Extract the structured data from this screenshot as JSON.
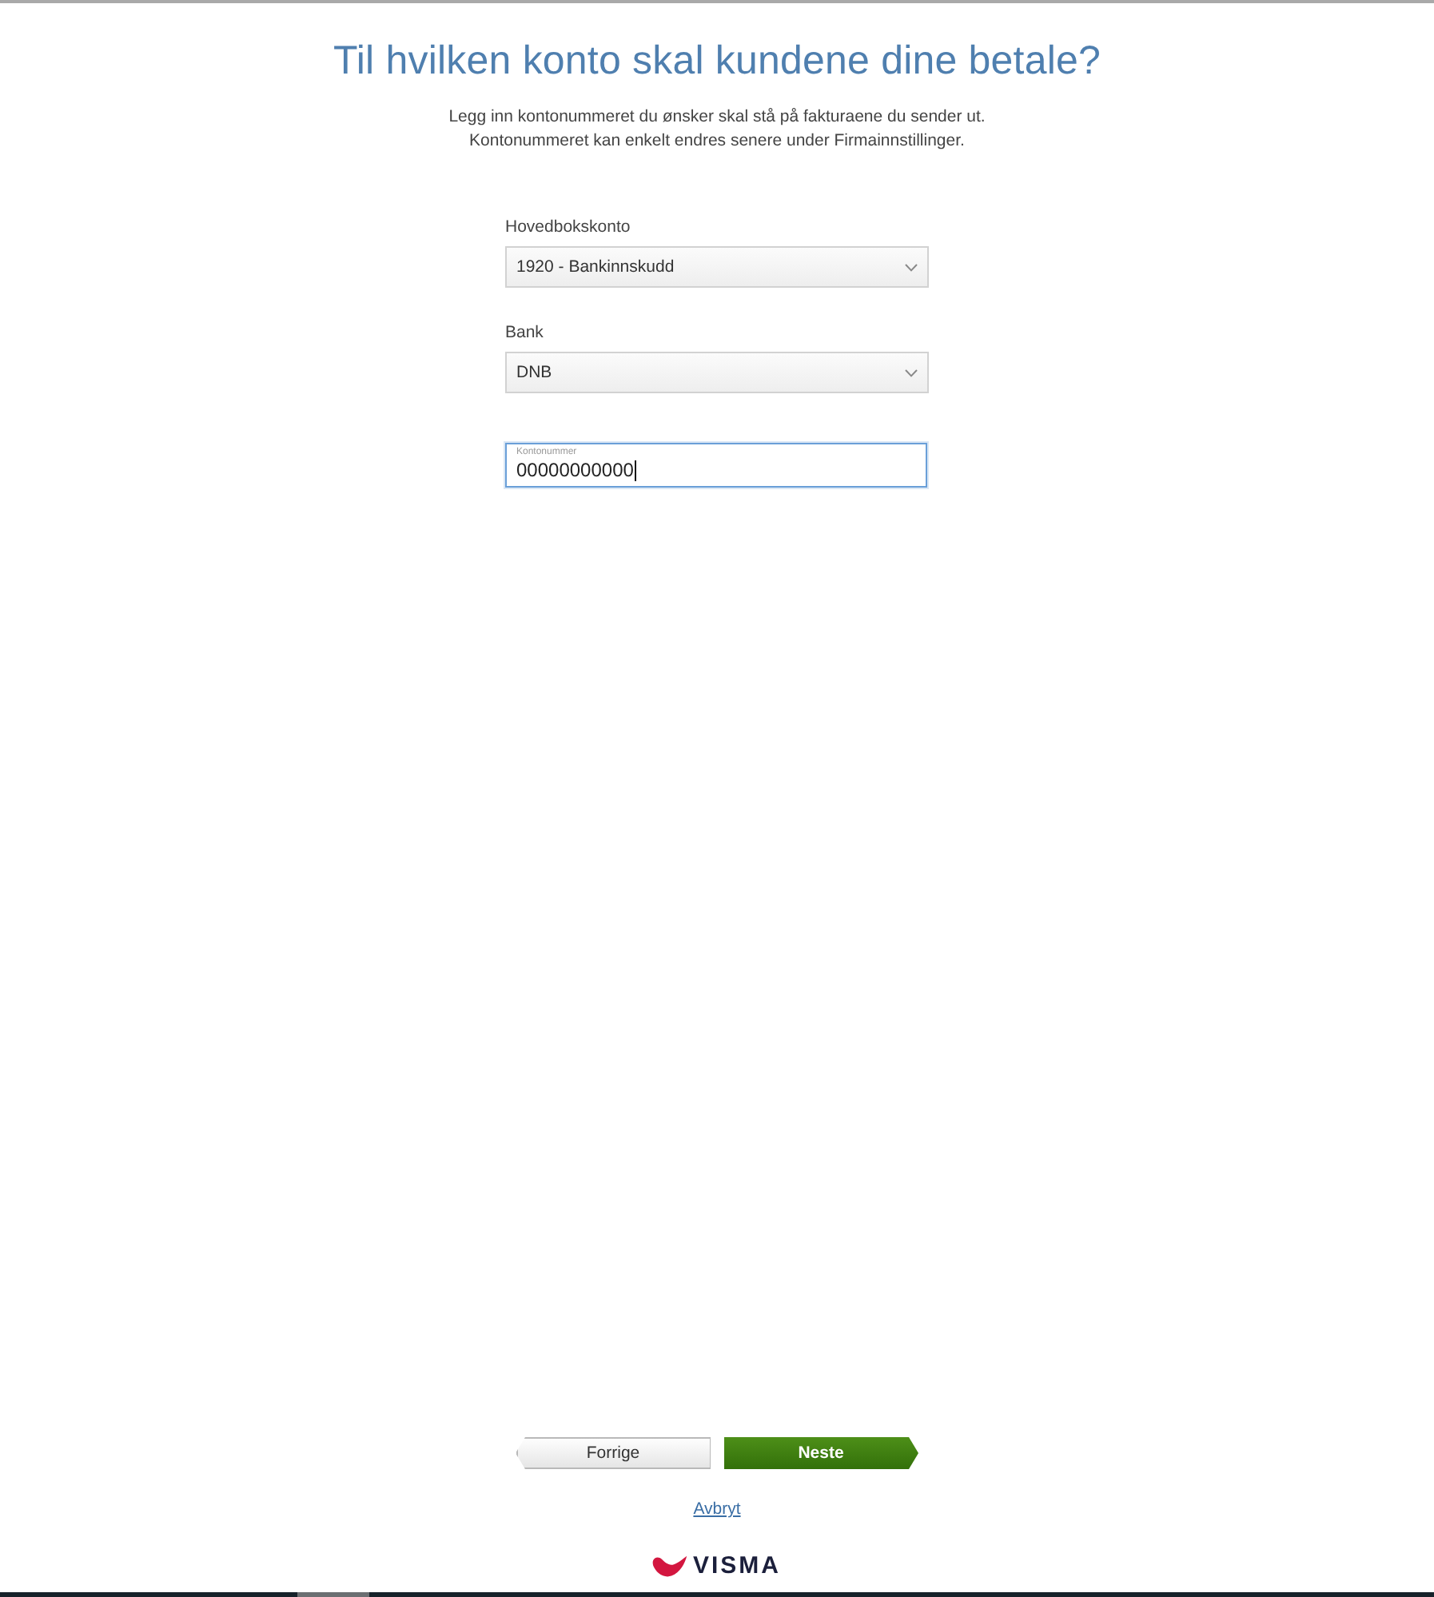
{
  "title": "Til hvilken konto skal kundene dine betale?",
  "intro": [
    "Legg inn kontonummeret du ønsker skal stå på fakturaene du sender ut.",
    "Kontonummeret kan enkelt endres senere under Firmainnstillinger."
  ],
  "fields": [
    {
      "kind": "select",
      "label": "Hovedbokskonto",
      "value": "1920 - Bankinnskudd"
    },
    {
      "kind": "select",
      "label": "Bank",
      "value": "DNB"
    },
    {
      "kind": "text",
      "label": "Kontonummer",
      "value": "00000000000",
      "focused": true
    }
  ],
  "buttons": [
    {
      "kind": "back",
      "label": "Forrige"
    },
    {
      "kind": "next",
      "label": "Neste"
    }
  ],
  "cancel_link": "Avbryt",
  "logo": {
    "text": "VISMA"
  }
}
